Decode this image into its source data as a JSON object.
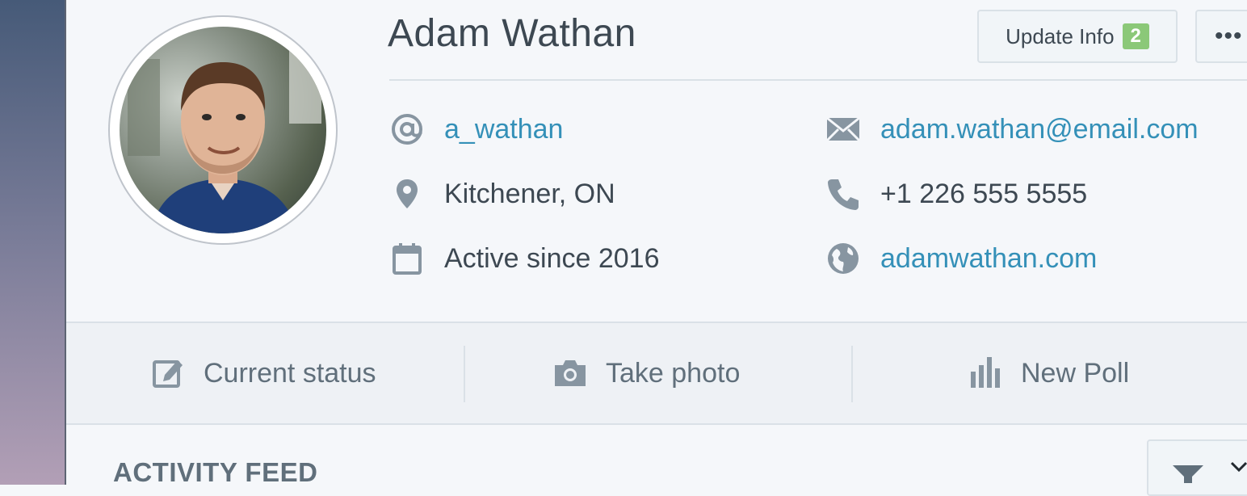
{
  "profile": {
    "name": "Adam Wathan",
    "username": "a_wathan",
    "email": "adam.wathan@email.com",
    "location": "Kitchener, ON",
    "phone": "+1 226 555 5555",
    "active_since": "Active since 2016",
    "website": "adamwathan.com"
  },
  "header_actions": {
    "update_label": "Update Info",
    "update_count": "2",
    "more_label": "•••"
  },
  "actions": {
    "current_status": "Current status",
    "take_photo": "Take photo",
    "new_poll": "New Poll"
  },
  "feed": {
    "title": "ACTIVITY FEED"
  },
  "colors": {
    "link": "#3490b8",
    "badge": "#8bc878",
    "text": "#3d4852",
    "muted": "#606f7b"
  },
  "icons": {
    "username": "at-icon",
    "email": "envelope-icon",
    "location": "map-pin-icon",
    "phone": "phone-icon",
    "active_since": "calendar-icon",
    "website": "globe-icon",
    "current_status": "edit-icon",
    "take_photo": "camera-icon",
    "new_poll": "bar-chart-icon",
    "filter": "filter-icon",
    "dropdown": "chevron-down-icon"
  }
}
